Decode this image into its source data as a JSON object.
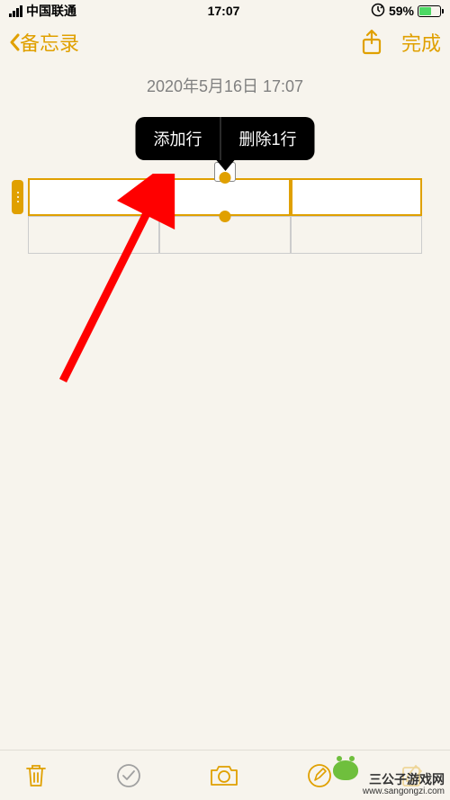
{
  "status_bar": {
    "carrier": "中国联通",
    "time": "17:07",
    "battery_pct": "59%"
  },
  "nav": {
    "back_label": "备忘录",
    "done_label": "完成"
  },
  "note": {
    "timestamp": "2020年5月16日 17:07"
  },
  "context_menu": {
    "add_row": "添加行",
    "delete_row": "删除1行"
  },
  "table": {
    "rows": 2,
    "cols": 3,
    "selected_row_index": 0
  },
  "watermark": {
    "brand": "三公子游戏网",
    "url": "www.sangongzi.com"
  },
  "colors": {
    "accent": "#e0a000",
    "arrow": "#ff0000"
  }
}
